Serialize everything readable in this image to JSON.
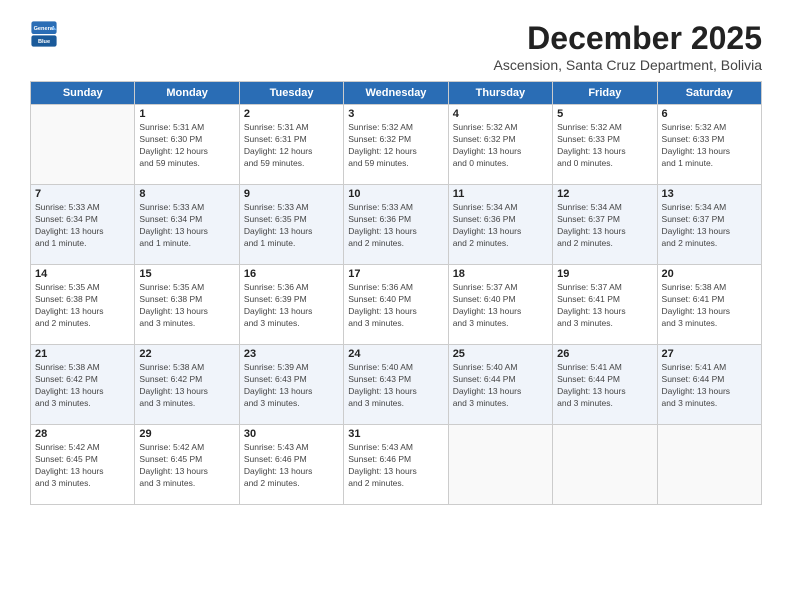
{
  "logo": {
    "general": "General",
    "blue": "Blue"
  },
  "title": "December 2025",
  "subtitle": "Ascension, Santa Cruz Department, Bolivia",
  "headers": [
    "Sunday",
    "Monday",
    "Tuesday",
    "Wednesday",
    "Thursday",
    "Friday",
    "Saturday"
  ],
  "weeks": [
    [
      {
        "day": "",
        "info": ""
      },
      {
        "day": "1",
        "info": "Sunrise: 5:31 AM\nSunset: 6:30 PM\nDaylight: 12 hours\nand 59 minutes."
      },
      {
        "day": "2",
        "info": "Sunrise: 5:31 AM\nSunset: 6:31 PM\nDaylight: 12 hours\nand 59 minutes."
      },
      {
        "day": "3",
        "info": "Sunrise: 5:32 AM\nSunset: 6:32 PM\nDaylight: 12 hours\nand 59 minutes."
      },
      {
        "day": "4",
        "info": "Sunrise: 5:32 AM\nSunset: 6:32 PM\nDaylight: 13 hours\nand 0 minutes."
      },
      {
        "day": "5",
        "info": "Sunrise: 5:32 AM\nSunset: 6:33 PM\nDaylight: 13 hours\nand 0 minutes."
      },
      {
        "day": "6",
        "info": "Sunrise: 5:32 AM\nSunset: 6:33 PM\nDaylight: 13 hours\nand 1 minute."
      }
    ],
    [
      {
        "day": "7",
        "info": "Sunrise: 5:33 AM\nSunset: 6:34 PM\nDaylight: 13 hours\nand 1 minute."
      },
      {
        "day": "8",
        "info": "Sunrise: 5:33 AM\nSunset: 6:34 PM\nDaylight: 13 hours\nand 1 minute."
      },
      {
        "day": "9",
        "info": "Sunrise: 5:33 AM\nSunset: 6:35 PM\nDaylight: 13 hours\nand 1 minute."
      },
      {
        "day": "10",
        "info": "Sunrise: 5:33 AM\nSunset: 6:36 PM\nDaylight: 13 hours\nand 2 minutes."
      },
      {
        "day": "11",
        "info": "Sunrise: 5:34 AM\nSunset: 6:36 PM\nDaylight: 13 hours\nand 2 minutes."
      },
      {
        "day": "12",
        "info": "Sunrise: 5:34 AM\nSunset: 6:37 PM\nDaylight: 13 hours\nand 2 minutes."
      },
      {
        "day": "13",
        "info": "Sunrise: 5:34 AM\nSunset: 6:37 PM\nDaylight: 13 hours\nand 2 minutes."
      }
    ],
    [
      {
        "day": "14",
        "info": "Sunrise: 5:35 AM\nSunset: 6:38 PM\nDaylight: 13 hours\nand 2 minutes."
      },
      {
        "day": "15",
        "info": "Sunrise: 5:35 AM\nSunset: 6:38 PM\nDaylight: 13 hours\nand 3 minutes."
      },
      {
        "day": "16",
        "info": "Sunrise: 5:36 AM\nSunset: 6:39 PM\nDaylight: 13 hours\nand 3 minutes."
      },
      {
        "day": "17",
        "info": "Sunrise: 5:36 AM\nSunset: 6:40 PM\nDaylight: 13 hours\nand 3 minutes."
      },
      {
        "day": "18",
        "info": "Sunrise: 5:37 AM\nSunset: 6:40 PM\nDaylight: 13 hours\nand 3 minutes."
      },
      {
        "day": "19",
        "info": "Sunrise: 5:37 AM\nSunset: 6:41 PM\nDaylight: 13 hours\nand 3 minutes."
      },
      {
        "day": "20",
        "info": "Sunrise: 5:38 AM\nSunset: 6:41 PM\nDaylight: 13 hours\nand 3 minutes."
      }
    ],
    [
      {
        "day": "21",
        "info": "Sunrise: 5:38 AM\nSunset: 6:42 PM\nDaylight: 13 hours\nand 3 minutes."
      },
      {
        "day": "22",
        "info": "Sunrise: 5:38 AM\nSunset: 6:42 PM\nDaylight: 13 hours\nand 3 minutes."
      },
      {
        "day": "23",
        "info": "Sunrise: 5:39 AM\nSunset: 6:43 PM\nDaylight: 13 hours\nand 3 minutes."
      },
      {
        "day": "24",
        "info": "Sunrise: 5:40 AM\nSunset: 6:43 PM\nDaylight: 13 hours\nand 3 minutes."
      },
      {
        "day": "25",
        "info": "Sunrise: 5:40 AM\nSunset: 6:44 PM\nDaylight: 13 hours\nand 3 minutes."
      },
      {
        "day": "26",
        "info": "Sunrise: 5:41 AM\nSunset: 6:44 PM\nDaylight: 13 hours\nand 3 minutes."
      },
      {
        "day": "27",
        "info": "Sunrise: 5:41 AM\nSunset: 6:44 PM\nDaylight: 13 hours\nand 3 minutes."
      }
    ],
    [
      {
        "day": "28",
        "info": "Sunrise: 5:42 AM\nSunset: 6:45 PM\nDaylight: 13 hours\nand 3 minutes."
      },
      {
        "day": "29",
        "info": "Sunrise: 5:42 AM\nSunset: 6:45 PM\nDaylight: 13 hours\nand 3 minutes."
      },
      {
        "day": "30",
        "info": "Sunrise: 5:43 AM\nSunset: 6:46 PM\nDaylight: 13 hours\nand 2 minutes."
      },
      {
        "day": "31",
        "info": "Sunrise: 5:43 AM\nSunset: 6:46 PM\nDaylight: 13 hours\nand 2 minutes."
      },
      {
        "day": "",
        "info": ""
      },
      {
        "day": "",
        "info": ""
      },
      {
        "day": "",
        "info": ""
      }
    ]
  ]
}
